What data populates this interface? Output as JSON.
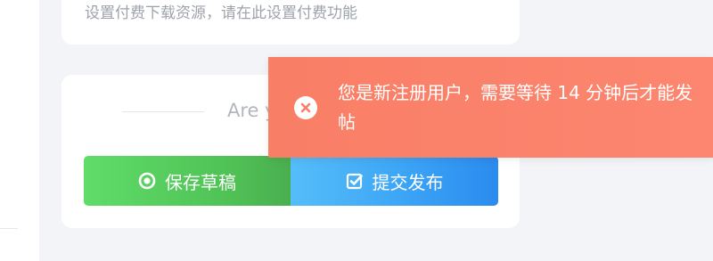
{
  "form": {
    "paid_hint": "设置付费下载资源，请在此设置付费功能",
    "confirm_text": "Are y"
  },
  "actions": {
    "save_draft_label": "保存草稿",
    "submit_label": "提交发布"
  },
  "toast": {
    "message": "您是新注册用户，需要等待 14 分钟后才能发帖",
    "color": "#fa8069"
  },
  "icons": {
    "save_draft": "target-circle-icon",
    "submit": "checkbox-icon",
    "toast_close": "close-circle-icon"
  },
  "colors": {
    "draft_green": "#55c95c",
    "submit_blue": "#3aa2f5"
  }
}
